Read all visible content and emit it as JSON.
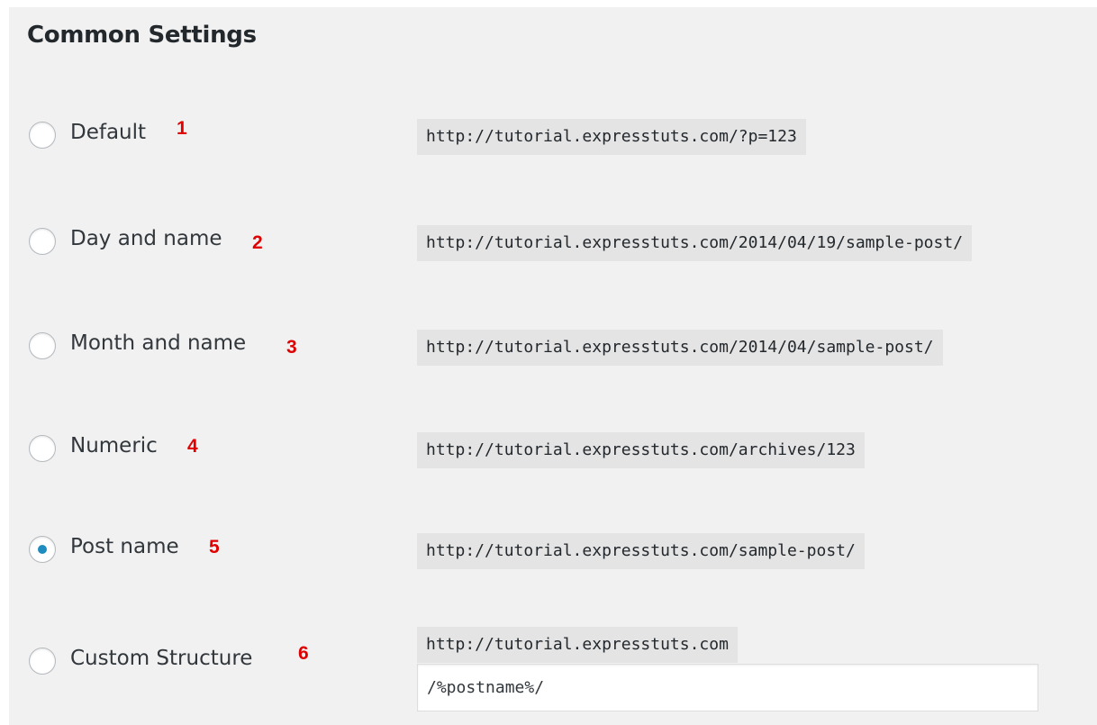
{
  "section": {
    "title": "Common Settings"
  },
  "options": [
    {
      "label": "Default",
      "marker": "1",
      "example": "http://tutorial.expresstuts.com/?p=123",
      "selected": false
    },
    {
      "label": "Day and name",
      "marker": "2",
      "example": "http://tutorial.expresstuts.com/2014/04/19/sample-post/",
      "selected": false
    },
    {
      "label": "Month and name",
      "marker": "3",
      "example": "http://tutorial.expresstuts.com/2014/04/sample-post/",
      "selected": false
    },
    {
      "label": "Numeric",
      "marker": "4",
      "example": "http://tutorial.expresstuts.com/archives/123",
      "selected": false
    },
    {
      "label": "Post name",
      "marker": "5",
      "example": "http://tutorial.expresstuts.com/sample-post/",
      "selected": true
    },
    {
      "label": "Custom Structure",
      "marker": "6",
      "example": "http://tutorial.expresstuts.com",
      "selected": false
    }
  ],
  "custom_structure": {
    "value": "/%postname%/"
  },
  "colors": {
    "accent": "#1e8cbe",
    "marker": "#e00000",
    "background": "#f1f1f1",
    "code_background": "#e4e4e4"
  }
}
